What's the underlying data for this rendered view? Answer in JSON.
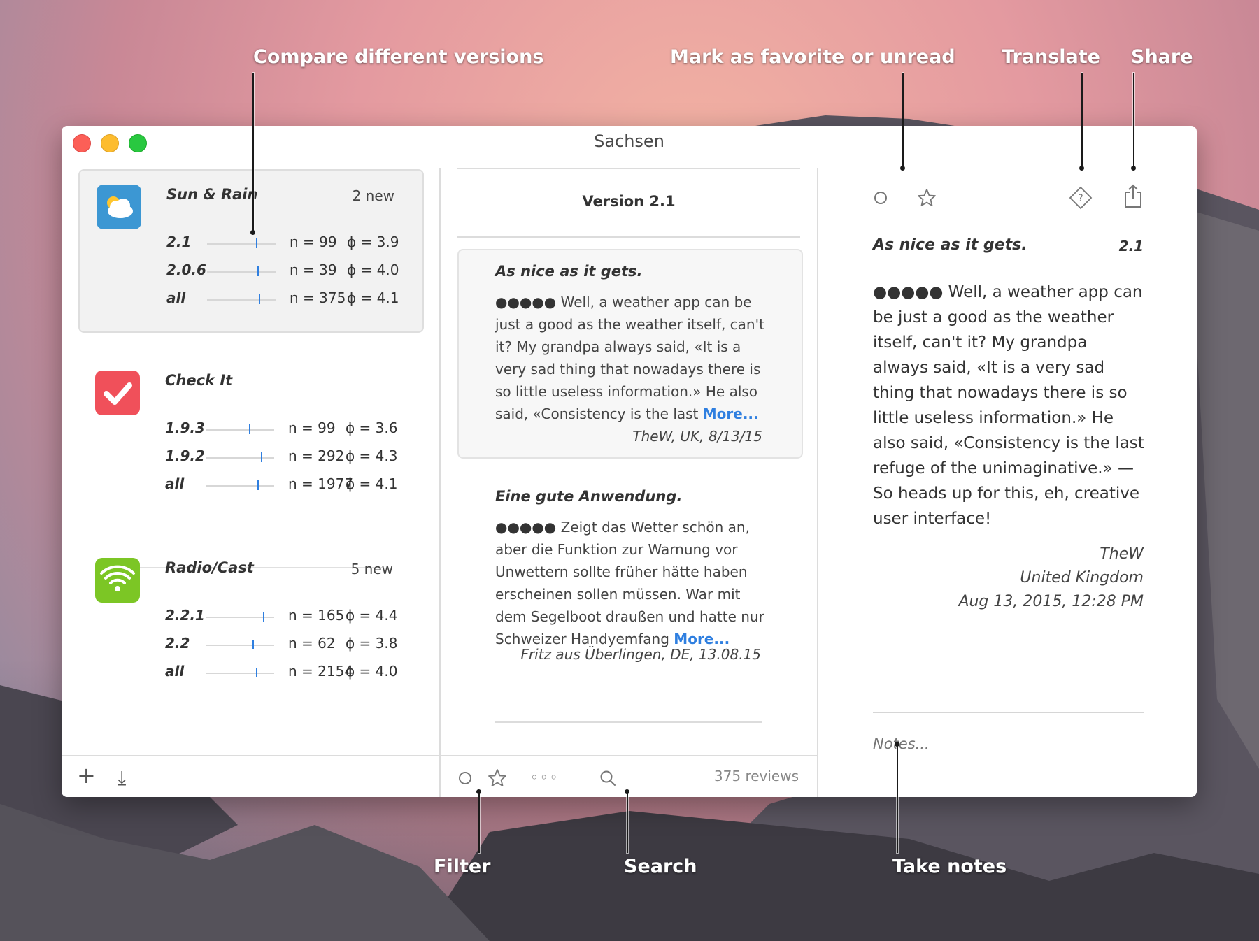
{
  "callouts": {
    "compare": "Compare different versions",
    "favorite": "Mark as favorite or unread",
    "translate": "Translate",
    "share": "Share",
    "filter": "Filter",
    "search": "Search",
    "notes": "Take notes"
  },
  "window": {
    "title": "Sachsen"
  },
  "sidebar": {
    "apps": [
      {
        "name": "Sun & Rain",
        "badge": "2 new",
        "versions": [
          {
            "version": "2.1",
            "n": "n = 99",
            "avg": "ϕ = 3.9",
            "rating": 3.9
          },
          {
            "version": "2.0.6",
            "n": "n = 39",
            "avg": "ϕ = 4.0",
            "rating": 4.0
          },
          {
            "version": "all",
            "n": "n = 375",
            "avg": "ϕ = 4.1",
            "rating": 4.1
          }
        ]
      },
      {
        "name": "Check It",
        "badge": "",
        "versions": [
          {
            "version": "1.9.3",
            "n": "n = 99",
            "avg": "ϕ = 3.6",
            "rating": 3.6
          },
          {
            "version": "1.9.2",
            "n": "n = 292",
            "avg": "ϕ = 4.3",
            "rating": 4.3
          },
          {
            "version": "all",
            "n": "n = 1977",
            "avg": "ϕ = 4.1",
            "rating": 4.1
          }
        ]
      },
      {
        "name": "Radio/Cast",
        "badge": "5 new",
        "versions": [
          {
            "version": "2.2.1",
            "n": "n = 165",
            "avg": "ϕ = 4.4",
            "rating": 4.4
          },
          {
            "version": "2.2",
            "n": "n = 62",
            "avg": "ϕ = 3.8",
            "rating": 3.8
          },
          {
            "version": "all",
            "n": "n = 2154",
            "avg": "ϕ = 4.0",
            "rating": 4.0
          }
        ]
      }
    ],
    "footer": {
      "add_icon": "+",
      "download_icon": "⤓"
    }
  },
  "middle": {
    "version_header": "Version 2.1",
    "reviews": [
      {
        "title": "As nice as it gets.",
        "stars": "●●●●●",
        "text": " Well, a weather app can be just a good as the weather itself, can't it? My grandpa always said, «It is a very sad thing that nowadays there is so little useless information.» He also said, «Consistency is the last ",
        "more": "More...",
        "meta": "TheW, UK, 8/13/15"
      },
      {
        "title": "Eine gute Anwendung.",
        "stars": "●●●●●",
        "text": " Zeigt das Wetter schön an, aber die Funktion zur Warnung vor Unwettern sollte früher hätte haben erscheinen sollen müssen. War mit dem Segelboot draußen und hatte nur Schweizer Handyemfang ",
        "more": "More...",
        "meta": "Fritz aus Überlingen, DE, 13.08.15"
      }
    ],
    "footer": {
      "count": "375 reviews",
      "more_icon": "◦◦◦"
    }
  },
  "detail": {
    "title": "As nice as it gets.",
    "version": "2.1",
    "stars": "●●●●●",
    "text": " Well, a weather app can be just a good as the weather itself, can't it? My grandpa always said, «It is a very sad thing that nowadays there is so little useless information.» He also said, «Consistency is the last refuge of the unimaginative.» — So heads up for this, eh, creative user interface!",
    "author": "TheW",
    "country": "United Kingdom",
    "date": "Aug 13, 2015, 12:28 PM",
    "notes_placeholder": "Notes..."
  },
  "colors": {
    "accent": "#2f7fe0",
    "close": "#fc5f57",
    "minimize": "#fdbc2e",
    "zoom": "#29c840"
  }
}
